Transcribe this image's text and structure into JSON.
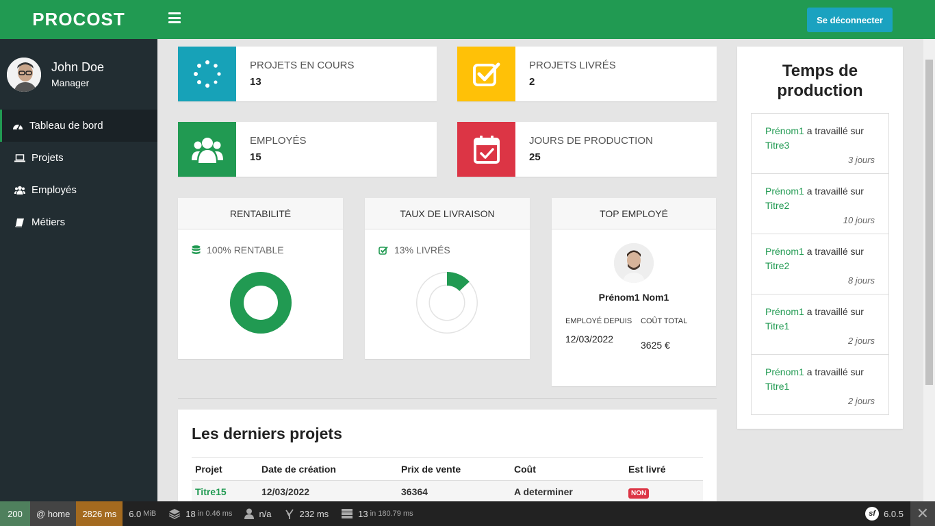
{
  "brand": "PROCOST",
  "user": {
    "name": "John Doe",
    "role": "Manager"
  },
  "menu": [
    {
      "label": "Tableau de bord",
      "icon": "dashboard-icon"
    },
    {
      "label": "Projets",
      "icon": "laptop-icon"
    },
    {
      "label": "Employés",
      "icon": "users-icon"
    },
    {
      "label": "Métiers",
      "icon": "book-icon"
    }
  ],
  "header": {
    "logout_label": "Se déconnecter"
  },
  "colors": {
    "green": "#219a52",
    "teal": "#17a2b8",
    "yellow": "#ffc107",
    "red": "#dc3545",
    "sidebar": "#222d32"
  },
  "stats": {
    "in_progress": {
      "label": "PROJETS EN COURS",
      "value": "13",
      "color": "#17a2b8",
      "icon": "spinner-icon"
    },
    "delivered": {
      "label": "PROJETS LIVRÉS",
      "value": "2",
      "color": "#ffc107",
      "icon": "check-square-icon"
    },
    "employees": {
      "label": "EMPLOYÉS",
      "value": "15",
      "color": "#219a52",
      "icon": "users-icon"
    },
    "production_days": {
      "label": "JOURS DE PRODUCTION",
      "value": "25",
      "color": "#dc3545",
      "icon": "calendar-check-icon"
    }
  },
  "profitability": {
    "title": "RENTABILITÉ",
    "stat": "100% RENTABLE",
    "fraction": 1.0
  },
  "delivery": {
    "title": "TAUX DE LIVRAISON",
    "stat": "13% LIVRÉS",
    "fraction": 0.13
  },
  "top_employee": {
    "title": "TOP EMPLOYÉ",
    "name": "Prénom1 Nom1",
    "since_label": "EMPLOYÉ DEPUIS",
    "since_value": "12/03/2022",
    "cost_label": "COÛT TOTAL",
    "cost_value": "3625 €"
  },
  "latest_projects": {
    "title": "Les derniers projets",
    "columns": [
      "Projet",
      "Date de création",
      "Prix de vente",
      "Coût",
      "Est livré"
    ],
    "rows": [
      {
        "project": "Titre15",
        "created": "12/03/2022",
        "price": "36364",
        "cost": "A determiner",
        "delivered": "NON"
      }
    ]
  },
  "production_time": {
    "title": "Temps de production",
    "worked_on": "a travaillé sur",
    "items": [
      {
        "employee": "Prénom1",
        "project": "Titre3",
        "days": "3 jours"
      },
      {
        "employee": "Prénom1",
        "project": "Titre2",
        "days": "10 jours"
      },
      {
        "employee": "Prénom1",
        "project": "Titre2",
        "days": "8 jours"
      },
      {
        "employee": "Prénom1",
        "project": "Titre1",
        "days": "2 jours"
      },
      {
        "employee": "Prénom1",
        "project": "Titre1",
        "days": "2 jours"
      }
    ]
  },
  "debug": {
    "status": "200",
    "route": "@ home",
    "time": "2826 ms",
    "memory": "6.0",
    "memory_unit": "MiB",
    "queries": "18",
    "queries_time": "in 0.46 ms",
    "user": "n/a",
    "twig": "232 ms",
    "db": "13",
    "db_time": "in 180.79 ms",
    "version": "6.0.5"
  }
}
